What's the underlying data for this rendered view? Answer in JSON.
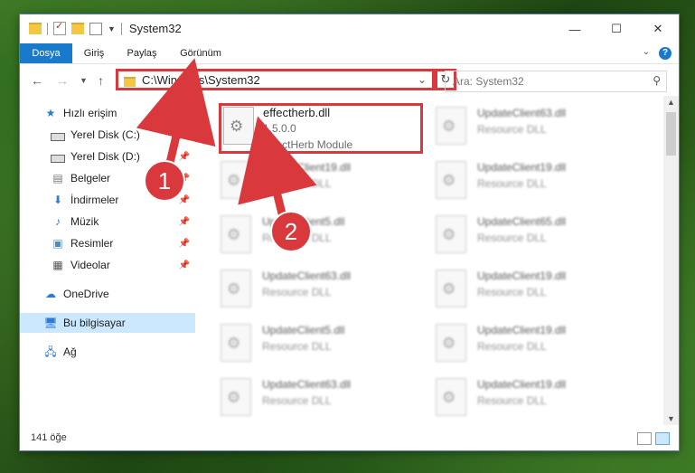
{
  "window": {
    "title": "System32"
  },
  "ribbon": {
    "tabs": [
      "Dosya",
      "Giriş",
      "Paylaş",
      "Görünüm"
    ]
  },
  "address": {
    "path": "C:\\Windows\\System32"
  },
  "search": {
    "placeholder": "Ara: System32"
  },
  "sidebar": {
    "items": [
      {
        "label": "Hızlı erişim"
      },
      {
        "label": "Yerel Disk (C:)"
      },
      {
        "label": "Yerel Disk (D:)"
      },
      {
        "label": "Belgeler"
      },
      {
        "label": "İndirmeler"
      },
      {
        "label": "Müzik"
      },
      {
        "label": "Resimler"
      },
      {
        "label": "Videolar"
      },
      {
        "label": "OneDrive"
      },
      {
        "label": "Bu bilgisayar"
      },
      {
        "label": "Ağ"
      }
    ]
  },
  "files": {
    "highlighted": {
      "name": "effectherb.dll",
      "version": "1.5.0.0",
      "description": "EffectHerb Module"
    },
    "others": [
      {
        "name": "UpdateClient63.dll",
        "description": "Resource DLL"
      },
      {
        "name": "UpdateClient19.dll",
        "description": "Resource DLL"
      },
      {
        "name": "UpdateClient19.dll",
        "description": "Resource DLL"
      },
      {
        "name": "UpdateClient5.dll",
        "description": "Resource DLL"
      },
      {
        "name": "UpdateClient65.dll",
        "description": "Resource DLL"
      },
      {
        "name": "UpdateClient63.dll",
        "description": "Resource DLL"
      },
      {
        "name": "UpdateClient19.dll",
        "description": "Resource DLL"
      },
      {
        "name": "UpdateClient5.dll",
        "description": "Resource DLL"
      },
      {
        "name": "UpdateClient19.dll",
        "description": "Resource DLL"
      },
      {
        "name": "UpdateClient63.dll",
        "description": "Resource DLL"
      },
      {
        "name": "UpdateClient19.dll",
        "description": "Resource DLL"
      }
    ]
  },
  "status": {
    "count": "141 öğe"
  },
  "annotations": {
    "step1": "1",
    "step2": "2"
  },
  "colors": {
    "accent": "#1979ca",
    "highlight": "#d9393d",
    "selected": "#cce8ff"
  }
}
